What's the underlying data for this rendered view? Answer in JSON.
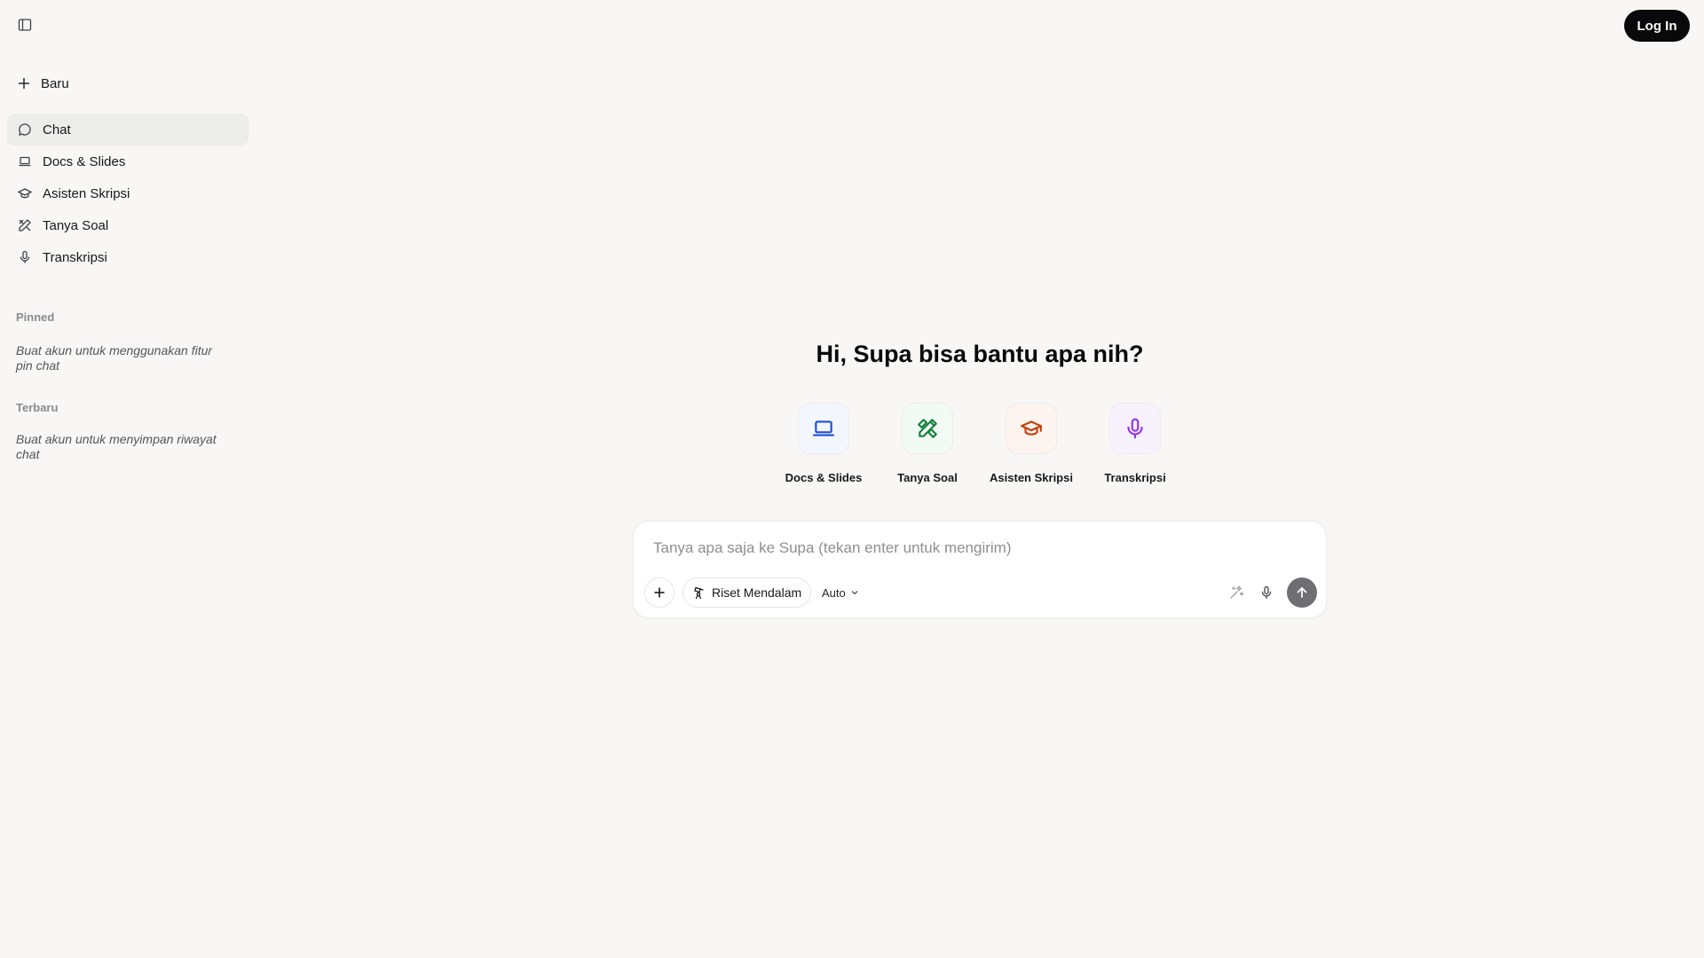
{
  "sidebar": {
    "new_label": "Baru",
    "items": [
      {
        "label": "Chat",
        "icon": "chat-bubble-icon",
        "active": true
      },
      {
        "label": "Docs & Slides",
        "icon": "laptop-icon"
      },
      {
        "label": "Asisten Skripsi",
        "icon": "graduation-cap-icon"
      },
      {
        "label": "Tanya Soal",
        "icon": "pencil-ruler-icon"
      },
      {
        "label": "Transkripsi",
        "icon": "microphone-icon"
      }
    ],
    "pinned_label": "Pinned",
    "pinned_note": "Buat akun untuk menggunakan fitur pin chat",
    "recent_label": "Terbaru",
    "recent_note": "Buat akun untuk menyimpan riwayat chat"
  },
  "header": {
    "login_label": "Log In"
  },
  "main": {
    "greeting": "Hi, Supa bisa bantu apa nih?",
    "features": [
      {
        "label": "Docs & Slides",
        "icon": "laptop-icon",
        "color": "#1d4ed8",
        "bg": "#f3f6fe"
      },
      {
        "label": "Tanya Soal",
        "icon": "pencil-ruler-icon",
        "color": "#15803d",
        "bg": "#f1fbf4"
      },
      {
        "label": "Asisten Skripsi",
        "icon": "graduation-cap-icon",
        "color": "#c2410c",
        "bg": "#fdf4ef"
      },
      {
        "label": "Transkripsi",
        "icon": "microphone-icon",
        "color": "#9333ea",
        "bg": "#f8f2fe"
      }
    ]
  },
  "composer": {
    "placeholder": "Tanya apa saja ke Supa (tekan enter untuk mengirim)",
    "value": "",
    "riset_label": "Riset Mendalam",
    "model_label": "Auto"
  },
  "colors": {
    "background": "#f8f7f6",
    "active_nav": "#ededec",
    "login_bg": "#09090b",
    "send_bg": "#6e6e73"
  }
}
